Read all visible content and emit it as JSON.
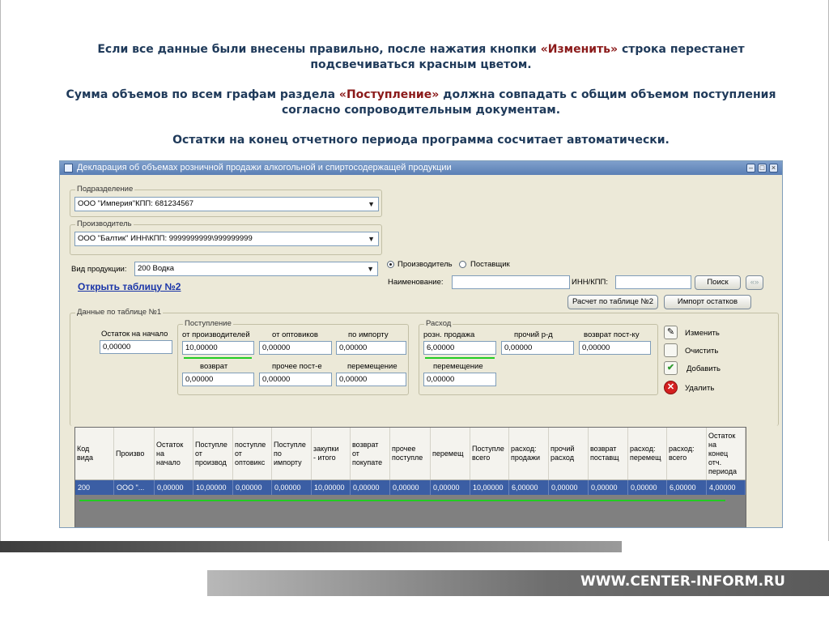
{
  "instructions": {
    "p1_part1": "Если все данные были внесены правильно, после нажатия кнопки ",
    "p1_accent": "«Изменить»",
    "p1_part2": " строка перестанет подсвечиваться красным цветом.",
    "p2_part1": "Сумма объемов по всем графам раздела ",
    "p2_accent": "«Поступление»",
    "p2_part2": " должна совпадать с общим объемом поступления согласно сопроводительным документам.",
    "p3": "Остатки на конец отчетного периода программа  сосчитает автоматически."
  },
  "window": {
    "title": "Декларация об объемах розничной продажи алкогольной и спиртосодержащей продукции",
    "controls": {
      "minimize": "–",
      "maximize": "□",
      "close": "×"
    }
  },
  "subdivision": {
    "label": "Подразделение",
    "value": "ООО \"Империя\"КПП: 681234567"
  },
  "producer": {
    "label": "Производитель",
    "value": "ООО \"Балтик\"   ИНН\\КПП: 9999999999\\999999999"
  },
  "product_type": {
    "label": "Вид продукции:",
    "value": "200 Водка"
  },
  "open_table_link": "Открыть таблицу №2",
  "search": {
    "radio_producer": "Производитель",
    "radio_supplier": "Поставщик",
    "name_label": "Наименование:",
    "name_value": "",
    "inn_label": "ИНН/КПП:",
    "inn_value": "",
    "search_button": "Поиск",
    "extra_button": "«»"
  },
  "buttons": {
    "calc_table2": "Расчет по таблице №2",
    "import_balances": "Импорт остатков",
    "edit": "Изменить",
    "clear": "Очистить",
    "add": "Добавить",
    "delete": "Удалить"
  },
  "table1": {
    "label": "Данные по таблице №1",
    "opening_label": "Остаток на начало",
    "opening_value": "0,00000",
    "income": {
      "label": "Поступление",
      "from_producers_label": "от производителей",
      "from_producers_value": "10,00000",
      "from_wholesalers_label": "от оптовиков",
      "from_wholesalers_value": "0,00000",
      "import_label": "по импорту",
      "import_value": "0,00000",
      "return_label": "возврат",
      "return_value": "0,00000",
      "other_label": "прочее пост-е",
      "other_value": "0,00000",
      "transfer_label": "перемещение",
      "transfer_value": "0,00000"
    },
    "expense": {
      "label": "Расход",
      "retail_label": "розн. продажа",
      "retail_value": "6,00000",
      "other_label": "прочий р-д",
      "other_value": "0,00000",
      "return_label": "возврат пост-ку",
      "return_value": "0,00000",
      "transfer_label": "перемещение",
      "transfer_value": "0,00000"
    }
  },
  "grid": {
    "headers": [
      "Код\nвида",
      "Произво",
      "Остаток\nна\nначало",
      "Поступле\nот\nпроизвод",
      "поступле\nот\nоптовикс",
      "Поступле\nпо\nимпорту",
      "закупки\n- итого",
      "возврат\nот\nпокупате",
      "прочее\nпоступле",
      "перемещ",
      "Поступле\nвсего",
      "расход:\nпродажи",
      "прочий\nрасход",
      "возврат\nпоставщ",
      "расход:\nперемещ",
      "расход:\nвсего",
      "Остаток\nна\nконец\nотч.\nпериода"
    ],
    "rows": [
      [
        "200",
        "ООО \"...",
        "0,00000",
        "10,00000",
        "0,00000",
        "0,00000",
        "10,00000",
        "0,00000",
        "0,00000",
        "0,00000",
        "10,00000",
        "6,00000",
        "0,00000",
        "0,00000",
        "0,00000",
        "6,00000",
        "4,00000"
      ]
    ]
  },
  "footer": {
    "website": "WWW.CENTER-INFORM.RU"
  },
  "colors": {
    "instruction_text": "#1f3a5a",
    "accent_text": "#8b1a1a",
    "selected_row": "#3b5ea4",
    "highlight_line": "#22cc22",
    "window_bg": "#ece9d8"
  }
}
